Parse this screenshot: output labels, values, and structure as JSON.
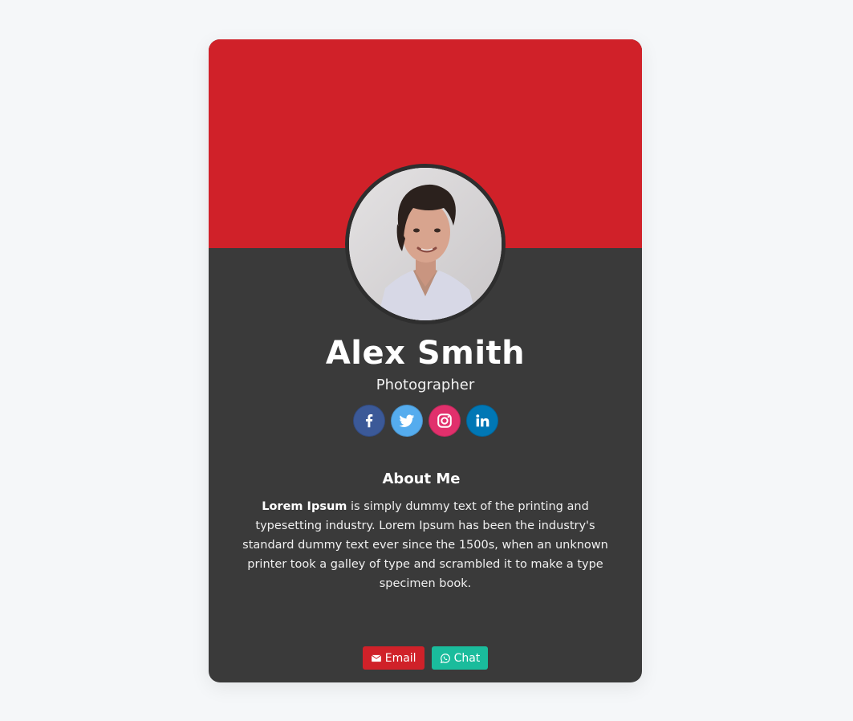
{
  "profile": {
    "name": "Alex Smith",
    "role": "Photographer",
    "avatar_alt": "profile photo"
  },
  "socials": [
    {
      "name": "facebook",
      "icon": "facebook-icon",
      "color": "#3b5998"
    },
    {
      "name": "twitter",
      "icon": "twitter-icon",
      "color": "#55acee"
    },
    {
      "name": "instagram",
      "icon": "instagram-icon",
      "color": "#e1306c"
    },
    {
      "name": "linkedin",
      "icon": "linkedin-icon",
      "color": "#0077b5"
    }
  ],
  "about": {
    "title": "About Me",
    "lead": "Lorem Ipsum",
    "text": " is simply dummy text of the printing and typesetting industry. Lorem Ipsum has been the industry's standard dummy text ever since the 1500s, when an unknown printer took a galley of type and scrambled it to make a type specimen book."
  },
  "actions": {
    "email_label": "Email",
    "email_icon": "envelope-icon",
    "email_color": "#d02129",
    "chat_label": "Chat",
    "chat_icon": "whatsapp-icon",
    "chat_color": "#1abc9c"
  },
  "colors": {
    "header": "#d02129",
    "card": "#3a3a3a",
    "background": "#f5f7f9"
  }
}
